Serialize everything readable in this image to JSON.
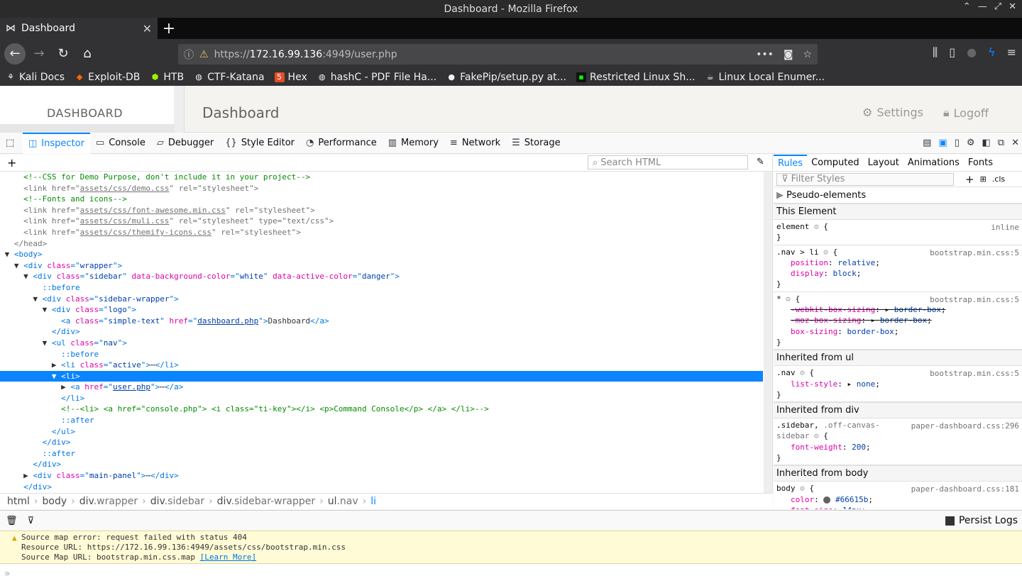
{
  "window": {
    "title": "Dashboard - Mozilla Firefox",
    "controls": [
      "⌃",
      "—",
      "⤢",
      "✕"
    ]
  },
  "tab": {
    "title": "Dashboard"
  },
  "url": {
    "scheme": "https://",
    "host": "172.16.99.136",
    "rest": ":4949/user.php"
  },
  "bookmarks": [
    "Kali Docs",
    "Exploit-DB",
    "HTB",
    "CTF-Katana",
    "Hex",
    "hashC - PDF File Ha...",
    "FakePip/setup.py at...",
    "Restricted Linux Sh...",
    "Linux Local Enumer..."
  ],
  "page": {
    "sidebar_title": "DASHBOARD",
    "main_title": "Dashboard",
    "settings": "Settings",
    "logoff": "Logoff"
  },
  "devtools": {
    "tabs": [
      "Inspector",
      "Console",
      "Debugger",
      "Style Editor",
      "Performance",
      "Memory",
      "Network",
      "Storage"
    ],
    "search_placeholder": "Search HTML"
  },
  "breadcrumbs": {
    "c0": "html",
    "c1": "body",
    "c2a": "div",
    "c2b": ".wrapper",
    "c3a": "div",
    "c3b": ".sidebar",
    "c4a": "div",
    "c4b": ".sidebar-wrapper",
    "c5a": "ul",
    "c5b": ".nav",
    "c6": "li"
  },
  "rules": {
    "tabs": [
      "Rules",
      "Computed",
      "Layout",
      "Animations",
      "Fonts"
    ],
    "filter": "Filter Styles",
    "cls": ".cls",
    "pseudo": "Pseudo-elements",
    "this_element": "This Element",
    "inh_ul": "Inherited from ul",
    "inh_div": "Inherited from div",
    "inh_body": "Inherited from body"
  },
  "console": {
    "persist": "Persist Logs",
    "warn_line1": "Source map error: request failed with status 404",
    "warn_line2": "Resource URL: https://172.16.99.136:4949/assets/css/bootstrap.min.css",
    "warn_line3": "Source Map URL: bootstrap.min.css.map",
    "learn_more": "[Learn More]",
    "prompt": "»"
  },
  "colors": {
    "accent": "#0a84ff",
    "dark": "#323234"
  }
}
